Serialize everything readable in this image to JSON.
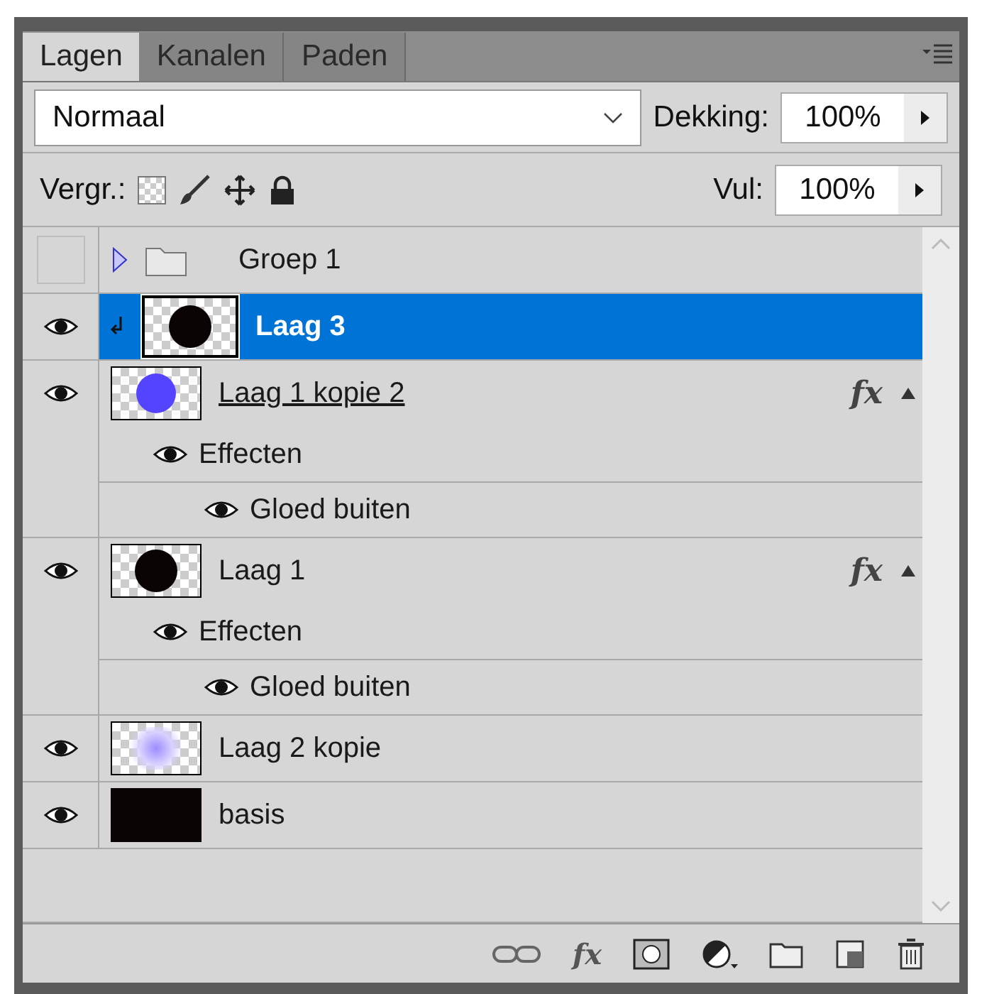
{
  "tabs": [
    {
      "label": "Lagen",
      "selected": true
    },
    {
      "label": "Kanalen",
      "selected": false
    },
    {
      "label": "Paden",
      "selected": false
    }
  ],
  "blend_mode": {
    "value": "Normaal"
  },
  "opacity": {
    "label": "Dekking:",
    "value": "100%"
  },
  "lock": {
    "label": "Vergr.:"
  },
  "fill": {
    "label": "Vul:",
    "value": "100%"
  },
  "layers": [
    {
      "kind": "group",
      "name": "Groep 1",
      "visible": false,
      "selected": false,
      "expanded": false,
      "clipped": false,
      "underlined": false,
      "thumbnail": {
        "kind": "folder"
      }
    },
    {
      "kind": "layer",
      "name": "Laag 3",
      "visible": true,
      "selected": true,
      "clipped": true,
      "underlined": false,
      "thumbnail": {
        "kind": "black-circle"
      }
    },
    {
      "kind": "layer",
      "name": "Laag 1 kopie 2",
      "visible": true,
      "selected": false,
      "clipped": false,
      "underlined": true,
      "thumbnail": {
        "kind": "blue-circle"
      },
      "fx_label": "fx",
      "expanded": true,
      "effects": [
        {
          "name": "Effecten",
          "visible": true,
          "children": [
            {
              "name": "Gloed buiten",
              "visible": true
            }
          ]
        }
      ]
    },
    {
      "kind": "layer",
      "name": "Laag 1",
      "visible": true,
      "selected": false,
      "clipped": false,
      "underlined": false,
      "thumbnail": {
        "kind": "black-blob"
      },
      "fx_label": "fx",
      "expanded": true,
      "effects": [
        {
          "name": "Effecten",
          "visible": true,
          "children": [
            {
              "name": "Gloed buiten",
              "visible": true
            }
          ]
        }
      ]
    },
    {
      "kind": "layer",
      "name": "Laag 2 kopie",
      "visible": true,
      "selected": false,
      "clipped": false,
      "underlined": false,
      "thumbnail": {
        "kind": "glow"
      }
    },
    {
      "kind": "layer",
      "name": "basis",
      "visible": true,
      "selected": false,
      "clipped": false,
      "underlined": false,
      "thumbnail": {
        "kind": "black-fill"
      }
    }
  ],
  "footer": {
    "style_button": "fx"
  }
}
